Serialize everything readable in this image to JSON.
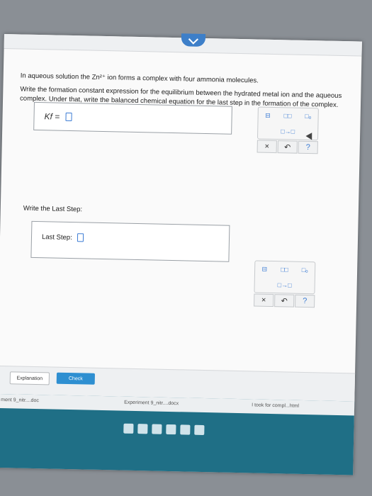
{
  "question": {
    "line1": "In aqueous solution the Zn²⁺ ion forms a complex with four ammonia molecules.",
    "line2": "Write the formation constant expression for the equilibrium between the hydrated metal ion and the aqueous complex. Under that, write the balanced chemical equation for the last step in the formation of the complex."
  },
  "kf_box": {
    "label": "Kf ="
  },
  "last_step": {
    "section_label": "Write the Last Step:",
    "label": "Last Step:"
  },
  "toolbox": {
    "arrow": "□→□",
    "clear": "×",
    "undo": "↶",
    "help": "?"
  },
  "buttons": {
    "explanation": "Explanation",
    "check": "Check"
  },
  "downloads": {
    "item1": "Experiment 9_nitr....docx",
    "item2": "ment 9_nitr....doc",
    "item3": "I took for compl...html"
  },
  "colors": {
    "accent": "#3b7bd4",
    "taskbar": "#1f6f86"
  }
}
